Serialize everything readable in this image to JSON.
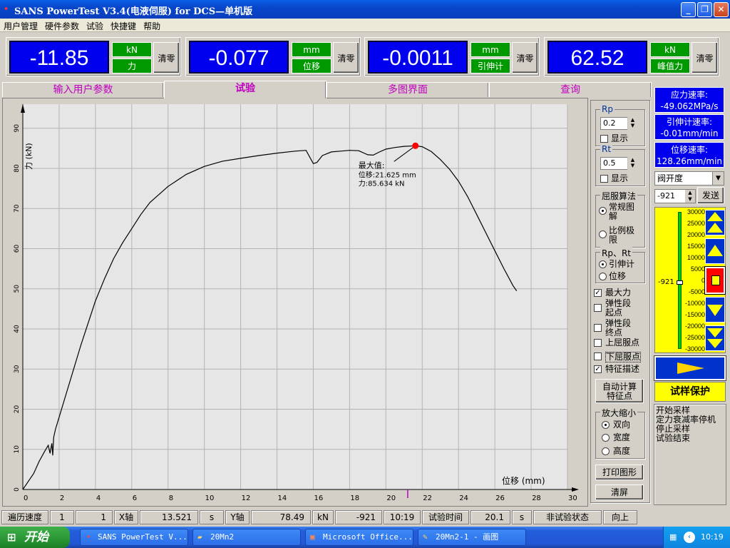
{
  "window": {
    "title": "SANS PowerTest V3.4(电液伺服) for DCS—单机版"
  },
  "menu": [
    "用户管理",
    "硬件参数",
    "试验",
    "快捷键",
    "帮助"
  ],
  "readouts": [
    {
      "value": "-11.85",
      "unit": "kN",
      "label": "力",
      "zero": "清零"
    },
    {
      "value": "-0.077",
      "unit": "mm",
      "label": "位移",
      "zero": "清零"
    },
    {
      "value": "-0.0011",
      "unit": "mm",
      "label": "引伸计",
      "zero": "清零"
    },
    {
      "value": "62.52",
      "unit": "kN",
      "label": "峰值力",
      "zero": "清零"
    }
  ],
  "tabs": [
    "输入用户参数",
    "试验",
    "多图界面",
    "查询"
  ],
  "rates": [
    {
      "label": "应力速率:",
      "value": "-49.062MPa/s"
    },
    {
      "label": "引伸计速率:",
      "value": "-0.01mm/min"
    },
    {
      "label": "位移速率:",
      "value": "128.26mm/min"
    }
  ],
  "panel": {
    "rp_label": "Rp",
    "rp_value": "0.2",
    "rt_label": "Rt",
    "rt_value": "0.5",
    "show": "显示",
    "yield_algo": "屈服算法",
    "algo_1": "常规图解",
    "algo_2": "比例极限",
    "rprt": "Rp、Rt",
    "src_1": "引伸计",
    "src_2": "位移",
    "checks": [
      "最大力",
      "弹性段起点",
      "弹性段终点",
      "上屈服点",
      "下屈服点",
      "特征描述"
    ],
    "auto_calc": "自动计算特征点",
    "zoom": "放大缩小",
    "zoom_1": "双向",
    "zoom_2": "宽度",
    "zoom_3": "高度",
    "print": "打印图形",
    "clear": "清屏"
  },
  "control": {
    "mode": "阀开度",
    "input": "-921",
    "send": "发送",
    "gauge_value": "-921",
    "gauge_fraction": 0.485,
    "scale": [
      "30000",
      "25000",
      "20000",
      "15000",
      "10000",
      "5000",
      "0",
      "-5000",
      "-10000",
      "-15000",
      "-20000",
      "-25000",
      "-30000"
    ],
    "protect": "试样保护",
    "log": [
      "开始采样",
      "定力衰减率停机",
      "停止采样",
      "试验结束"
    ]
  },
  "chart_data": {
    "type": "line",
    "xlabel": "位移  (mm)",
    "ylabel": "力 (kN)",
    "xlim": [
      0,
      30
    ],
    "ylim": [
      0,
      96
    ],
    "xticks": [
      0,
      2,
      4,
      6,
      8,
      10,
      12,
      14,
      16,
      18,
      20,
      22,
      24,
      26,
      28,
      30
    ],
    "yticks": [
      0,
      10,
      20,
      30,
      40,
      50,
      60,
      70,
      80,
      90
    ],
    "x": [
      0,
      0.3,
      0.6,
      0.9,
      1.2,
      1.4,
      1.5,
      1.6,
      1.65,
      1.7,
      1.8,
      2,
      2.4,
      2.8,
      3.2,
      3.6,
      4,
      4.5,
      5,
      5.5,
      6,
      6.5,
      7,
      7.5,
      8,
      9,
      10,
      11,
      12,
      13,
      14,
      15,
      15.6,
      16,
      16.2,
      16.5,
      17,
      17.5,
      18,
      18.5,
      19,
      19.3,
      19.6,
      20,
      20.5,
      21,
      21.625,
      22,
      22.5,
      23,
      23.5,
      24,
      24.5,
      25,
      25.5,
      26,
      26.5,
      27,
      27.2
    ],
    "y": [
      0,
      2,
      4,
      7,
      9.5,
      11,
      9,
      11.5,
      8.5,
      13,
      15,
      18,
      24,
      30,
      36,
      41.5,
      47,
      52.5,
      57.5,
      61.5,
      65,
      68.5,
      71.5,
      73.5,
      75.5,
      78.5,
      80.5,
      81.8,
      82.5,
      83.2,
      83.8,
      84.3,
      84.5,
      81.2,
      81.5,
      83.2,
      84.1,
      84.3,
      84.5,
      84.4,
      83.4,
      83.3,
      84,
      84.8,
      85.2,
      85.5,
      85.634,
      85.4,
      84.2,
      82.2,
      79.8,
      76.8,
      73,
      68.5,
      64,
      59.5,
      55,
      50.8,
      49.5
    ],
    "annotation": {
      "title": "最大值:",
      "line1": "位移:21.625 mm",
      "line2": "力:85.634 kN",
      "x": 21.625,
      "y": 85.634
    }
  },
  "status": {
    "c1": "遍历速度",
    "c2": "1",
    "c3": "1",
    "c4": "X轴",
    "c5": "13.521",
    "c6": "s",
    "c7": "Y轴",
    "c8": "78.49",
    "c9": "kN",
    "c10": "-921",
    "c11": "10:19",
    "c12": "试验时间",
    "c13": "20.1",
    "c14": "s",
    "c15": "非试验状态",
    "c16": "向上"
  },
  "taskbar": {
    "start": "开始",
    "items": [
      "SANS PowerTest V...",
      "20Mn2",
      "Microsoft Office...",
      "20Mn2-1 - 画图"
    ],
    "clock": "10:19"
  },
  "colors": {
    "display_bg": "#0000ee",
    "tag_green": "#009900",
    "gauge_yellow": "#ffff00",
    "marker_red": "#ff0000"
  }
}
